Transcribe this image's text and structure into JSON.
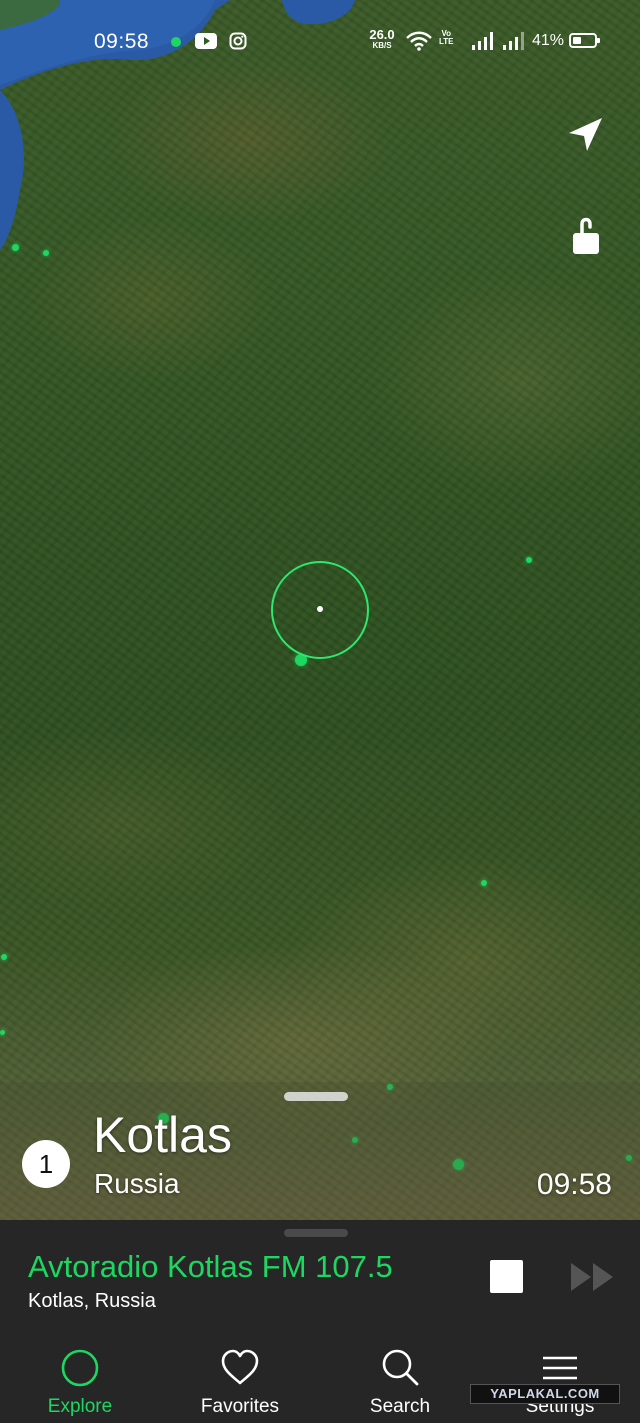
{
  "status_bar": {
    "time": "09:58",
    "network_speed_value": "26.0",
    "network_speed_unit": "KB/S",
    "volte_label": "Vo",
    "lte_label": "LTE",
    "battery_percent": "41%",
    "battery_level": 0.41,
    "icons": [
      "notification-dot-icon",
      "youtube-icon",
      "instagram-icon",
      "wifi-icon",
      "signal-icon",
      "signal-icon",
      "battery-icon"
    ]
  },
  "map": {
    "controls": [
      "locate-arrow-icon",
      "unlock-icon"
    ],
    "accent_color": "#1ed760"
  },
  "place_card": {
    "station_count": "1",
    "city": "Kotlas",
    "country": "Russia",
    "local_time": "09:58"
  },
  "now_playing": {
    "station": "Avtoradio Kotlas FM 107.5",
    "location": "Kotlas, Russia",
    "controls": [
      "stop-icon",
      "fast-forward-icon"
    ]
  },
  "nav": {
    "items": [
      {
        "label": "Explore",
        "icon": "explore-circle-icon",
        "active": true
      },
      {
        "label": "Favorites",
        "icon": "heart-icon",
        "active": false
      },
      {
        "label": "Search",
        "icon": "search-icon",
        "active": false
      },
      {
        "label": "Settings",
        "icon": "menu-icon",
        "active": false
      }
    ]
  },
  "watermark": "YAPLAKAL.COM"
}
